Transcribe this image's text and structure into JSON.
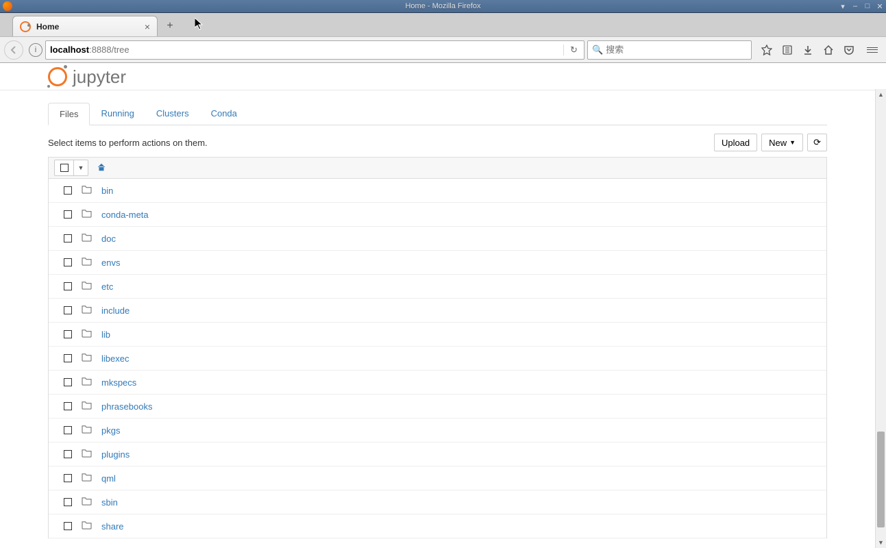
{
  "window": {
    "title": "Home - Mozilla Firefox"
  },
  "browser": {
    "tab_title": "Home",
    "url_host": "localhost",
    "url_port": ":8888",
    "url_path": "/tree",
    "search_placeholder": "搜索"
  },
  "jupyter": {
    "logo_text": "jupyter",
    "tabs": [
      {
        "label": "Files",
        "active": true
      },
      {
        "label": "Running",
        "active": false
      },
      {
        "label": "Clusters",
        "active": false
      },
      {
        "label": "Conda",
        "active": false
      }
    ],
    "hint": "Select items to perform actions on them.",
    "buttons": {
      "upload": "Upload",
      "new": "New",
      "refresh": "⟳"
    },
    "files": [
      {
        "name": "bin"
      },
      {
        "name": "conda-meta"
      },
      {
        "name": "doc"
      },
      {
        "name": "envs"
      },
      {
        "name": "etc"
      },
      {
        "name": "include"
      },
      {
        "name": "lib"
      },
      {
        "name": "libexec"
      },
      {
        "name": "mkspecs"
      },
      {
        "name": "phrasebooks"
      },
      {
        "name": "pkgs"
      },
      {
        "name": "plugins"
      },
      {
        "name": "qml"
      },
      {
        "name": "sbin"
      },
      {
        "name": "share"
      }
    ]
  }
}
